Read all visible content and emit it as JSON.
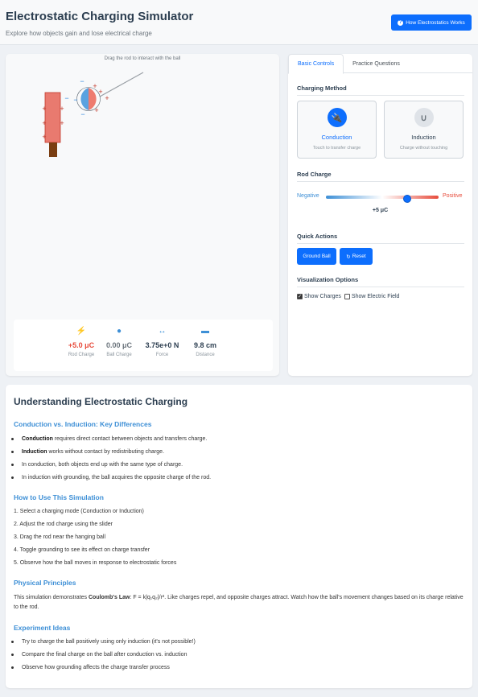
{
  "header": {
    "title": "Electrostatic Charging Simulator",
    "subtitle": "Explore how objects gain and lose electrical charge",
    "how_button": "How Electrostatics Works"
  },
  "simulation": {
    "drag_hint": "Drag the rod to interact with the ball",
    "rod_charge_signs": [
      "+",
      "+",
      "+",
      "+",
      "+"
    ],
    "ball_signs": {
      "negative": [
        "−",
        "−",
        "−",
        "−"
      ],
      "positive": [
        "+",
        "+",
        "+",
        "+"
      ]
    }
  },
  "stats": [
    {
      "icon": "lightning-icon",
      "glyph": "⚡",
      "value": "+5.0 μC",
      "label": "Rod Charge",
      "color": "#e74c3c"
    },
    {
      "icon": "ball-icon",
      "glyph": "●",
      "value": "0.00 μC",
      "label": "Ball Charge",
      "color": "#6c757d"
    },
    {
      "icon": "arrows-horizontal-icon",
      "glyph": "↔",
      "value": "3.75e+0 N",
      "label": "Force",
      "color": "#2c3e50"
    },
    {
      "icon": "ruler-icon",
      "glyph": "▬",
      "value": "9.8 cm",
      "label": "Distance",
      "color": "#2c3e50"
    }
  ],
  "controls": {
    "tabs": [
      "Basic Controls",
      "Practice Questions"
    ],
    "charging_method_title": "Charging Method",
    "methods": [
      {
        "name": "Conduction",
        "desc": "Touch to transfer charge",
        "icon": "plug-icon",
        "active": true
      },
      {
        "name": "Induction",
        "desc": "Charge without touching",
        "icon": "magnet-icon",
        "active": false
      }
    ],
    "rod_charge_title": "Rod Charge",
    "negative_label": "Negative",
    "positive_label": "Positive",
    "rod_charge_value": "+5 μC",
    "rod_charge_level": 0.72,
    "quick_actions_title": "Quick Actions",
    "ground_button": "Ground Ball",
    "reset_button": "Reset",
    "viz_title": "Visualization Options",
    "show_charges": "Show Charges",
    "show_field": "Show Electric Field",
    "show_charges_checked": true,
    "show_field_checked": false
  },
  "info": {
    "title": "Understanding Electrostatic Charging",
    "s1_title": "Conduction vs. Induction: Key Differences",
    "s1_items": [
      {
        "bold": "Conduction",
        "text": " requires direct contact between objects and transfers charge."
      },
      {
        "bold": "Induction",
        "text": " works without contact by redistributing charge."
      },
      {
        "bold": "",
        "text": "In conduction, both objects end up with the same type of charge."
      },
      {
        "bold": "",
        "text": "In induction with grounding, the ball acquires the opposite charge of the rod."
      }
    ],
    "s2_title": "How to Use This Simulation",
    "s2_items": [
      "1. Select a charging mode (Conduction or Induction)",
      "2. Adjust the rod charge using the slider",
      "3. Drag the rod near the hanging ball",
      "4. Toggle grounding to see its effect on charge transfer",
      "5. Observe how the ball moves in response to electrostatic forces"
    ],
    "s3_title": "Physical Principles",
    "s3_pre": "This simulation demonstrates ",
    "s3_bold": "Coulomb's Law",
    "s3_post": ": F = k|q₁q₂|/r². Like charges repel, and opposite charges attract. Watch how the ball's movement changes based on its charge relative to the rod.",
    "s4_title": "Experiment Ideas",
    "s4_items": [
      "Try to charge the ball positively using only induction (it's not possible!)",
      "Compare the final charge on the ball after conduction vs. induction",
      "Observe how grounding affects the charge transfer process"
    ]
  }
}
